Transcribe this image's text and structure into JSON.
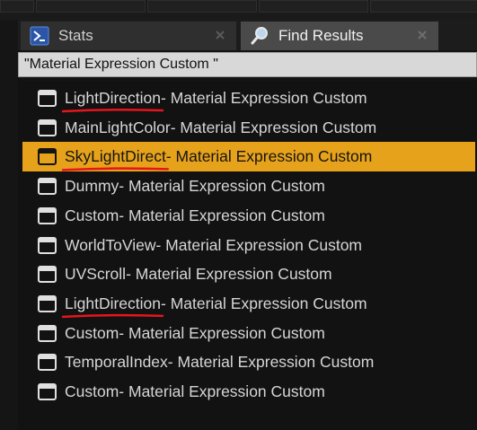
{
  "tabs": [
    {
      "label": "Stats",
      "icon": "terminal-icon",
      "active": false
    },
    {
      "label": "Find Results",
      "icon": "magnifier-icon",
      "active": true
    }
  ],
  "search": {
    "value": "\"Material Expression Custom \""
  },
  "results": [
    {
      "name": "LightDirection",
      "suffix": " - Material Expression Custom",
      "selected": false,
      "underlined": true
    },
    {
      "name": "MainLightColor",
      "suffix": " - Material Expression Custom",
      "selected": false,
      "underlined": false
    },
    {
      "name": "SkyLightDirect",
      "suffix": " - Material Expression Custom",
      "selected": true,
      "underlined": true
    },
    {
      "name": "Dummy",
      "suffix": " - Material Expression Custom",
      "selected": false,
      "underlined": false
    },
    {
      "name": "Custom",
      "suffix": " - Material Expression Custom",
      "selected": false,
      "underlined": false
    },
    {
      "name": "WorldToView",
      "suffix": " - Material Expression Custom",
      "selected": false,
      "underlined": false
    },
    {
      "name": "UVScroll",
      "suffix": " - Material Expression Custom",
      "selected": false,
      "underlined": false
    },
    {
      "name": "LightDirection",
      "suffix": " - Material Expression Custom",
      "selected": false,
      "underlined": true
    },
    {
      "name": "Custom",
      "suffix": " - Material Expression Custom",
      "selected": false,
      "underlined": false
    },
    {
      "name": "TemporalIndex",
      "suffix": " - Material Expression Custom",
      "selected": false,
      "underlined": false
    },
    {
      "name": "Custom",
      "suffix": " - Material Expression Custom",
      "selected": false,
      "underlined": false
    }
  ],
  "colors": {
    "selection": "#e6a21a",
    "annotation_underline": "#e8141c",
    "text": "#d6d6d6"
  }
}
